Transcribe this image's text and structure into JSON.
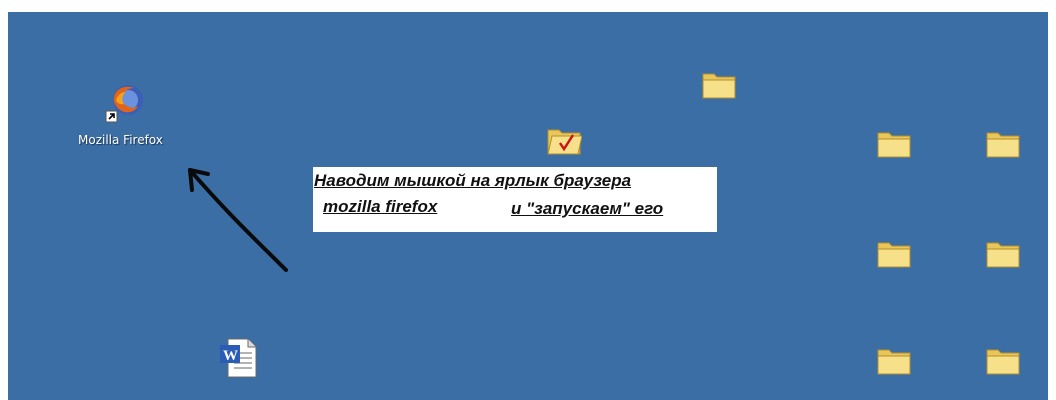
{
  "desktop": {
    "background_color": "#3a6ea5",
    "icons": [
      {
        "name": "firefox",
        "label": "Mozilla Firefox",
        "type": "shortcut"
      },
      {
        "name": "word-document",
        "label": "",
        "type": "file"
      }
    ],
    "folder_color": "#f6e08a"
  },
  "annotation": {
    "line1": "Наводим мышкой на ярлык браузера",
    "line2_left": "mozilla firefox",
    "line2_right": "и \"запускаем\" его"
  }
}
